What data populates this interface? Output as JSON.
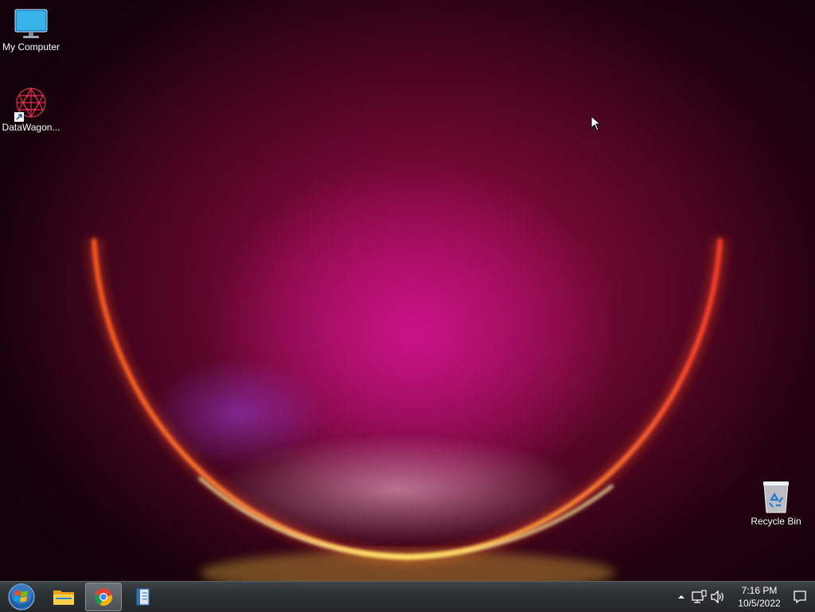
{
  "desktop": {
    "icons": [
      {
        "label": "My Computer",
        "icon": "monitor-icon"
      },
      {
        "label": "DataWagon...",
        "icon": "datawagon-shortcut-icon"
      },
      {
        "label": "Recycle Bin",
        "icon": "recycle-bin-icon"
      }
    ]
  },
  "taskbar": {
    "start": {
      "icon": "windows-start-orb-icon"
    },
    "pinned": [
      {
        "name": "File Explorer",
        "icon": "folder-icon",
        "active": false
      },
      {
        "name": "Google Chrome",
        "icon": "chrome-icon",
        "active": true
      },
      {
        "name": "Document App",
        "icon": "book-icon",
        "active": false
      }
    ],
    "tray": {
      "icons": [
        "chevron-up-icon",
        "network-icon",
        "volume-icon",
        "notification-icon"
      ],
      "time": "7:16 PM",
      "date": "10/5/2022"
    }
  },
  "colors": {
    "taskbar": "#2b3033",
    "wallpaper_core": "#c8147c",
    "wallpaper_rim": "#ffd23c"
  }
}
